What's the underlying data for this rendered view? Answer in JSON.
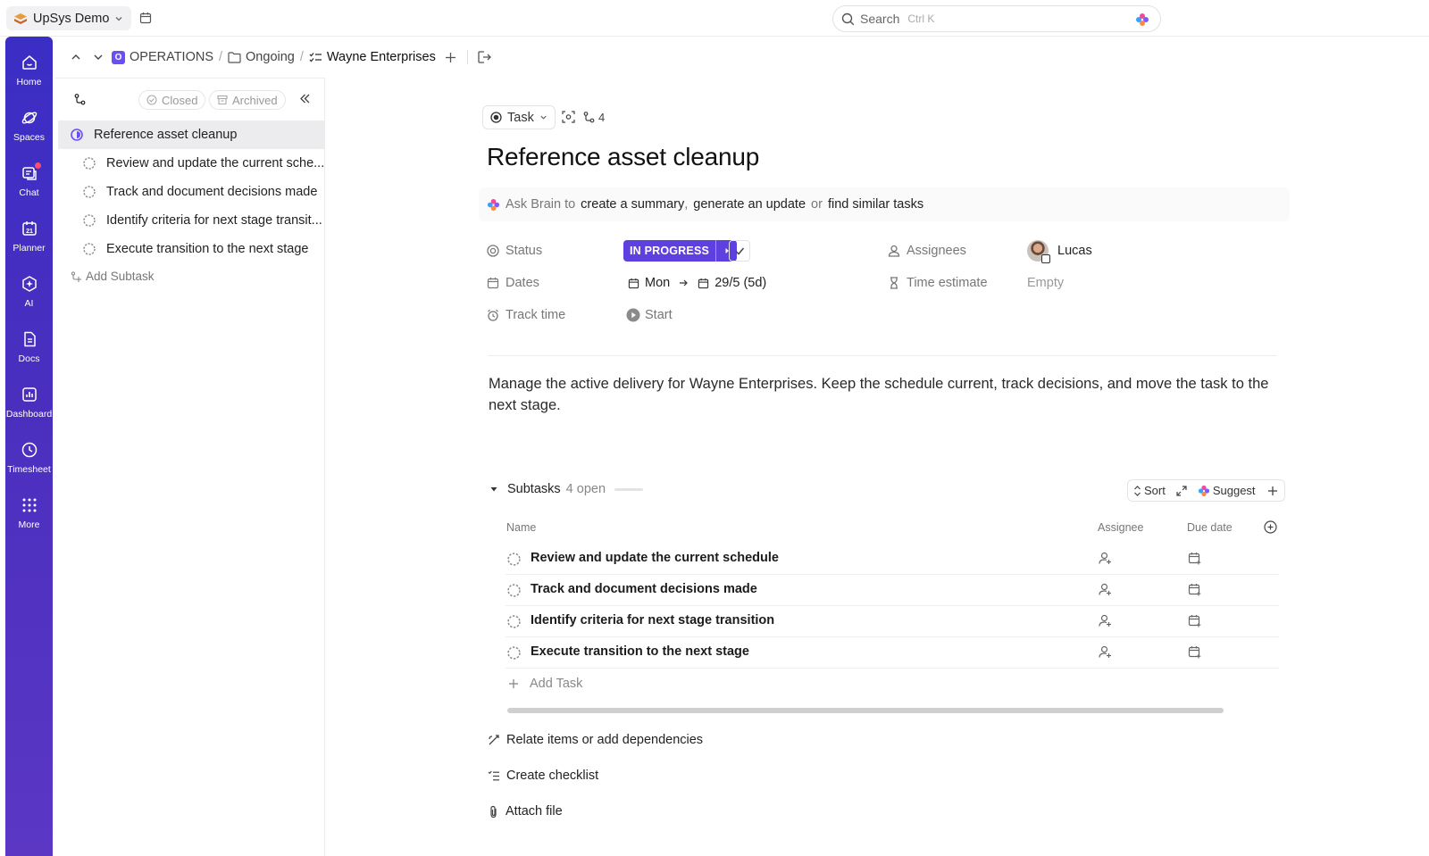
{
  "topbar": {
    "workspace": "UpSys Demo",
    "search_placeholder": "Search",
    "search_shortcut": "Ctrl K"
  },
  "rail": {
    "items": [
      {
        "label": "Home",
        "icon": "home-icon"
      },
      {
        "label": "Spaces",
        "icon": "planet-icon"
      },
      {
        "label": "Chat",
        "icon": "chat-icon"
      },
      {
        "label": "Planner",
        "icon": "calendar-icon"
      },
      {
        "label": "AI",
        "icon": "ai-icon"
      },
      {
        "label": "Docs",
        "icon": "doc-icon"
      },
      {
        "label": "Dashboard",
        "icon": "chart-icon"
      },
      {
        "label": "Timesheet",
        "icon": "clock-icon"
      },
      {
        "label": "More",
        "icon": "grid-dots-icon"
      }
    ]
  },
  "breadcrumb": {
    "space_badge": "O",
    "space": "OPERATIONS",
    "folder": "Ongoing",
    "list": "Wayne Enterprises"
  },
  "sidepanel": {
    "filter_closed": "Closed",
    "filter_archived": "Archived",
    "items": [
      "Reference asset cleanup",
      "Review and update the current sche...",
      "Track and document decisions made",
      "Identify criteria for next stage transit...",
      "Execute transition to the next stage"
    ],
    "add_subtask": "Add Subtask"
  },
  "task": {
    "type": "Task",
    "subtask_count": "4",
    "title": "Reference asset cleanup",
    "brain": {
      "prefix": "Ask Brain to",
      "link1": "create a summary",
      "comma": ",",
      "link2": "generate an update",
      "or": "or",
      "link3": "find similar tasks"
    },
    "props": {
      "status_label": "Status",
      "status_value": "IN PROGRESS",
      "dates_label": "Dates",
      "date_start": "Mon",
      "date_end": "29/5 (5d)",
      "track_label": "Track time",
      "track_action": "Start",
      "assignees_label": "Assignees",
      "assignee_name": "Lucas",
      "estimate_label": "Time estimate",
      "estimate_value": "Empty"
    },
    "description": "Manage the active delivery for Wayne Enterprises. Keep the schedule current, track decisions, and move the task to the next stage."
  },
  "subtasks": {
    "heading": "Subtasks",
    "open_count": "4 open",
    "sort": "Sort",
    "suggest": "Suggest",
    "columns": {
      "name": "Name",
      "assignee": "Assignee",
      "due": "Due date"
    },
    "rows": [
      "Review and update the current schedule",
      "Track and document decisions made",
      "Identify criteria for next stage transition",
      "Execute transition to the next stage"
    ],
    "add_task": "Add Task"
  },
  "actions": {
    "relate": "Relate items or add dependencies",
    "checklist": "Create checklist",
    "attach": "Attach file"
  },
  "colors": {
    "rail": "#4a2fbf",
    "status": "#5e3fe0"
  }
}
